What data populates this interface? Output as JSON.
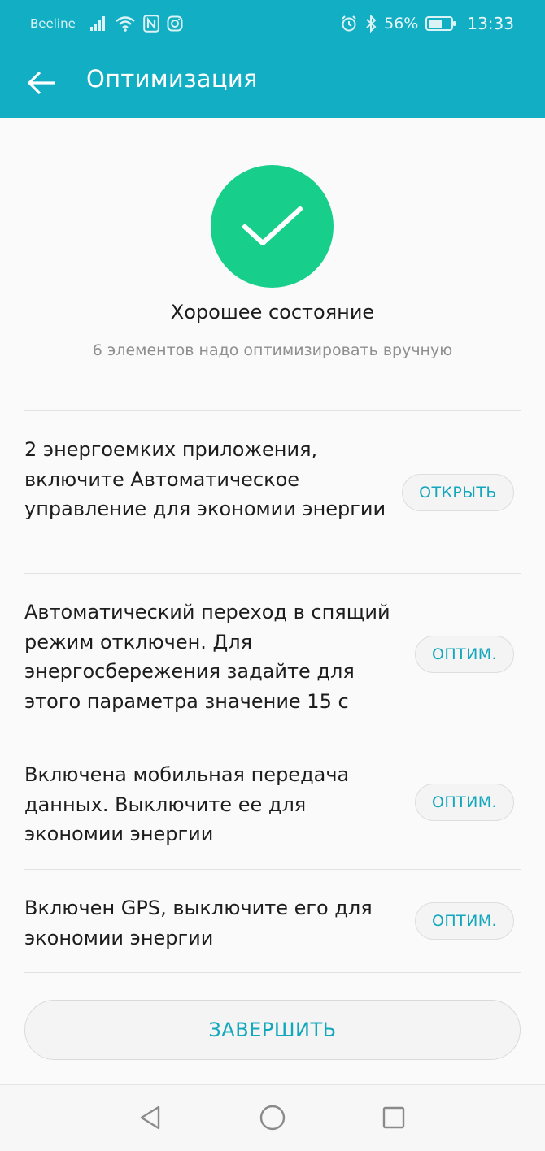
{
  "status_bar": {
    "carrier": "Beeline",
    "battery_percent": "56%",
    "time": "13:33",
    "icons": [
      "signal-icon",
      "wifi-icon",
      "nfc-icon",
      "instagram-icon",
      "alarm-icon",
      "bluetooth-icon",
      "battery-icon"
    ]
  },
  "app_bar": {
    "title": "Оптимизация",
    "back_icon": "back-arrow-icon"
  },
  "summary": {
    "status_icon": "check-icon",
    "title": "Хорошее состояние",
    "subtitle": "6 элементов надо оптимизировать вручную"
  },
  "items": [
    {
      "text": "2 энергоемких приложения, включите Автоматическое управление для экономии энергии",
      "button": "ОТКРЫТЬ"
    },
    {
      "text": "Автоматический переход в спящий режим отключен. Для энергосбережения задайте для этого параметра значение 15 с",
      "button": "ОПТИМ."
    },
    {
      "text": "Включена мобильная передача данных. Выключите ее для экономии энергии",
      "button": "ОПТИМ."
    },
    {
      "text": "Включен GPS, выключите его для экономии энергии",
      "button": "ОПТИМ."
    }
  ],
  "finish_button": "ЗАВЕРШИТЬ",
  "nav_bar": {
    "icons": [
      "back-triangle-icon",
      "home-circle-icon",
      "recents-square-icon"
    ]
  },
  "colors": {
    "header": "#12aec3",
    "accent": "#12a7bc",
    "success": "#17cf8a",
    "background": "#fafafa"
  }
}
